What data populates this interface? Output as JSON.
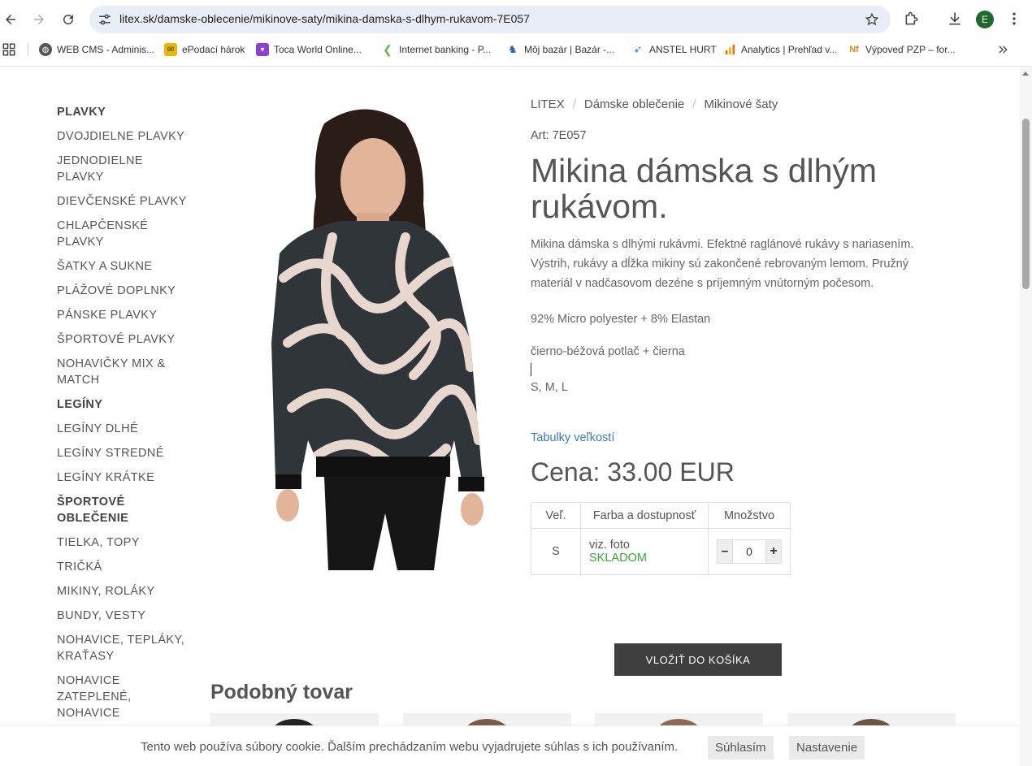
{
  "browser": {
    "url": "litex.sk/damske-oblecenie/mikinove-saty/mikina-damska-s-dlhym-rukavom-7E057",
    "profile_initial": "E",
    "bookmarks": [
      {
        "label": "WEB CMS - Adminis...",
        "icon": "globe-icon"
      },
      {
        "label": "ePodací hárok",
        "icon": "epodaci-icon"
      },
      {
        "label": "Toca World Online...",
        "icon": "toca-icon"
      },
      {
        "label": "Internet banking - P...",
        "icon": "bank-icon"
      },
      {
        "label": "Môj bazár | Bazár -...",
        "icon": "bazar-icon"
      },
      {
        "label": "ANSTEL HURT",
        "icon": "anstel-icon"
      },
      {
        "label": "Analytics | Prehľad v...",
        "icon": "analytics-icon"
      },
      {
        "label": "Výpoveď PZP – for...",
        "icon": "nf-icon"
      }
    ]
  },
  "sidebar": {
    "items": [
      {
        "label": "PLAVKY",
        "head": true
      },
      {
        "label": "DVOJDIELNE PLAVKY"
      },
      {
        "label": "JEDNODIELNE PLAVKY"
      },
      {
        "label": "DIEVČENSKÉ PLAVKY"
      },
      {
        "label": "CHLAPČENSKÉ PLAVKY"
      },
      {
        "label": "ŠATKY A SUKNE"
      },
      {
        "label": "PLÁŽOVÉ DOPLNKY"
      },
      {
        "label": "PÁNSKE PLAVKY"
      },
      {
        "label": "ŠPORTOVÉ PLAVKY"
      },
      {
        "label": "NOHAVIČKY MIX & MATCH"
      },
      {
        "label": "LEGÍNY",
        "head": true
      },
      {
        "label": "LEGÍNY DLHÉ"
      },
      {
        "label": "LEGÍNY STREDNÉ"
      },
      {
        "label": "LEGÍNY KRÁTKE"
      },
      {
        "label": "ŠPORTOVÉ OBLEČENIE",
        "head": true
      },
      {
        "label": "TIELKA, TOPY"
      },
      {
        "label": "TRIČKÁ"
      },
      {
        "label": "MIKINY, ROLÁKY"
      },
      {
        "label": "BUNDY, VESTY"
      },
      {
        "label": "NOHAVICE, TEPLÁKY, KRAŤASY"
      },
      {
        "label": "NOHAVICE ZATEPLENÉ, NOHAVICE"
      }
    ]
  },
  "product": {
    "breadcrumb": [
      "LITEX",
      "Dámske oblečenie",
      "Mikinové šaty"
    ],
    "art": "Art: 7E057",
    "title": "Mikina dámska s dlhým rukávom.",
    "description": "Mikina dámska s dlhými rukávmi. Efektné raglánové rukávy s nariasením. Výstrih, rukávy a dĺžka mikiny sú zakončené rebrovaným lemom. Pružný materiál v nadčasovom dezéne s príjemným vnútorným počesom.",
    "material": "92% Micro polyester + 8% Elastan",
    "color": "čierno-béžová potlač + čierna",
    "sizes": "S, M, L",
    "size_table_link": "Tabulky veľkostí",
    "price": "Cena: 33.00 EUR",
    "table": {
      "headers": [
        "Veľ.",
        "Farba a dostupnosť",
        "Množstvo"
      ],
      "row": {
        "size": "S",
        "color": "viz. foto",
        "stock": "SKLADOM",
        "qty": "0"
      }
    },
    "add_to_cart": "VLOŽIŤ DO KOŠÍKA"
  },
  "similar": {
    "title": "Podobný tovar"
  },
  "cookie": {
    "message": "Tento web používa súbory cookie. Ďalším prechádzaním webu vyjadrujete súhlas s ich používaním.",
    "accept": "Súhlasím",
    "settings": "Nastavenie"
  }
}
